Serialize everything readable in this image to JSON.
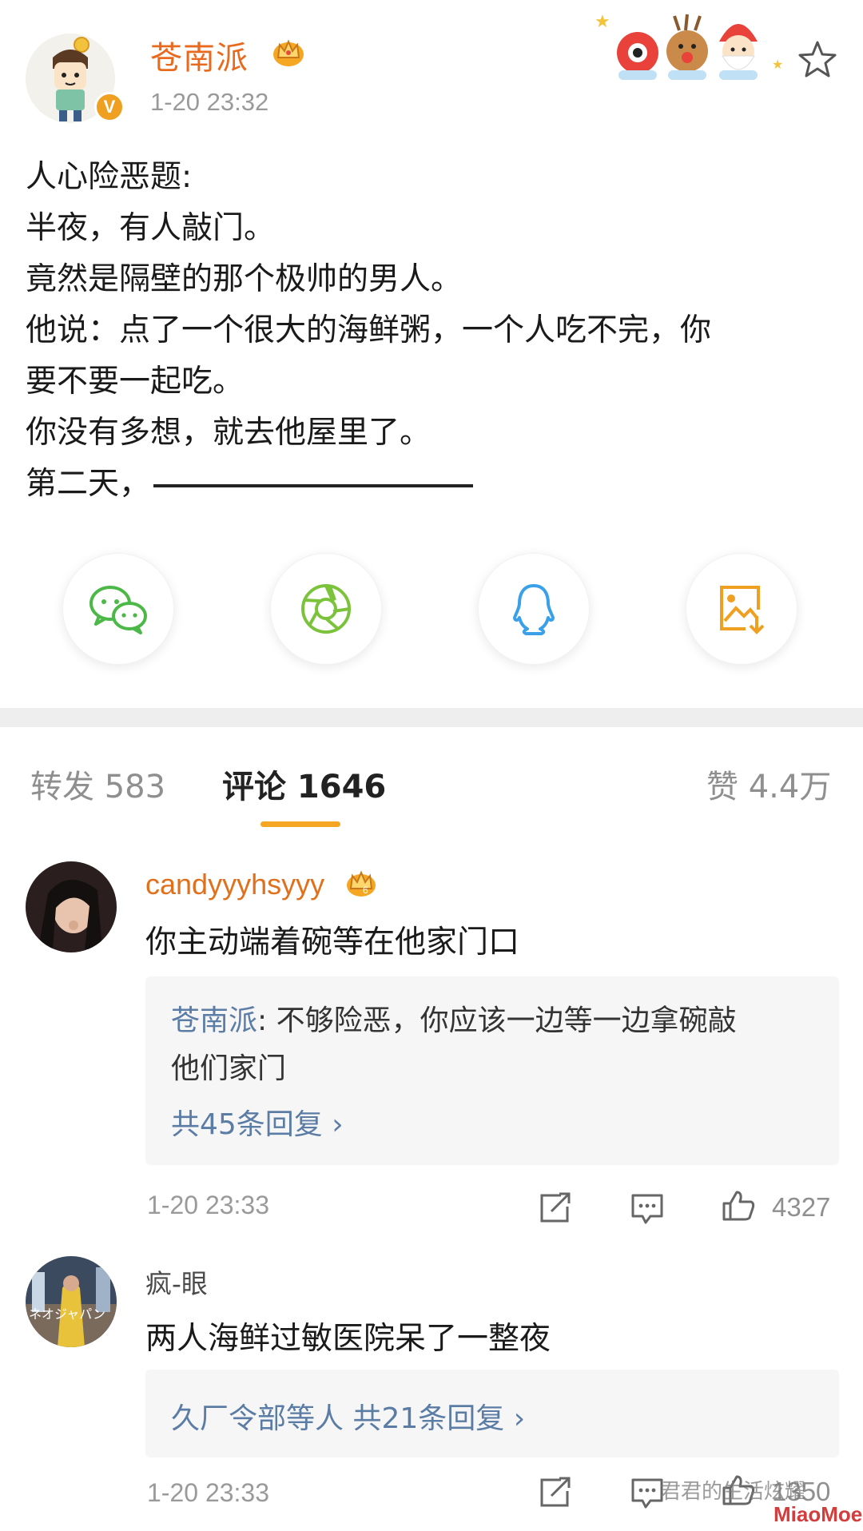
{
  "post": {
    "author": "苍南派",
    "time": "1-20 23:32",
    "verified_badge": "V",
    "lines": [
      "人心险恶题:",
      "半夜，有人敲门。",
      "竟然是隔壁的那个极帅的男人。",
      "他说：点了一个很大的海鲜粥，一个人吃不完，你",
      "要不要一起吃。",
      "你没有多想，就去他屋里了。",
      "第二天，"
    ]
  },
  "share": [
    "wechat-icon",
    "moments-icon",
    "qq-icon",
    "save-image-icon"
  ],
  "tabs": {
    "repost": "转发 583",
    "comments": "评论 1646",
    "likes": "赞 4.4万"
  },
  "comments": [
    {
      "user": "candyyyhsyyy",
      "text": "你主动端着碗等在他家门口",
      "reply_author": "苍南派",
      "reply_line1": ": 不够险恶，你应该一边等一边拿碗敲",
      "reply_line2": "他们家门",
      "reply_more": "共45条回复 ›",
      "time": "1-20 23:33",
      "likes": "4327"
    },
    {
      "user": "疯-眼",
      "text": "两人海鲜过敏医院呆了一整夜",
      "reply_more": "久厂令部等人  共21条回复 ›",
      "time": "1-20 23:33",
      "likes": "1350"
    }
  ],
  "watermark": "君君的生活炫耀",
  "watermark_logo": "MiaoMoe"
}
